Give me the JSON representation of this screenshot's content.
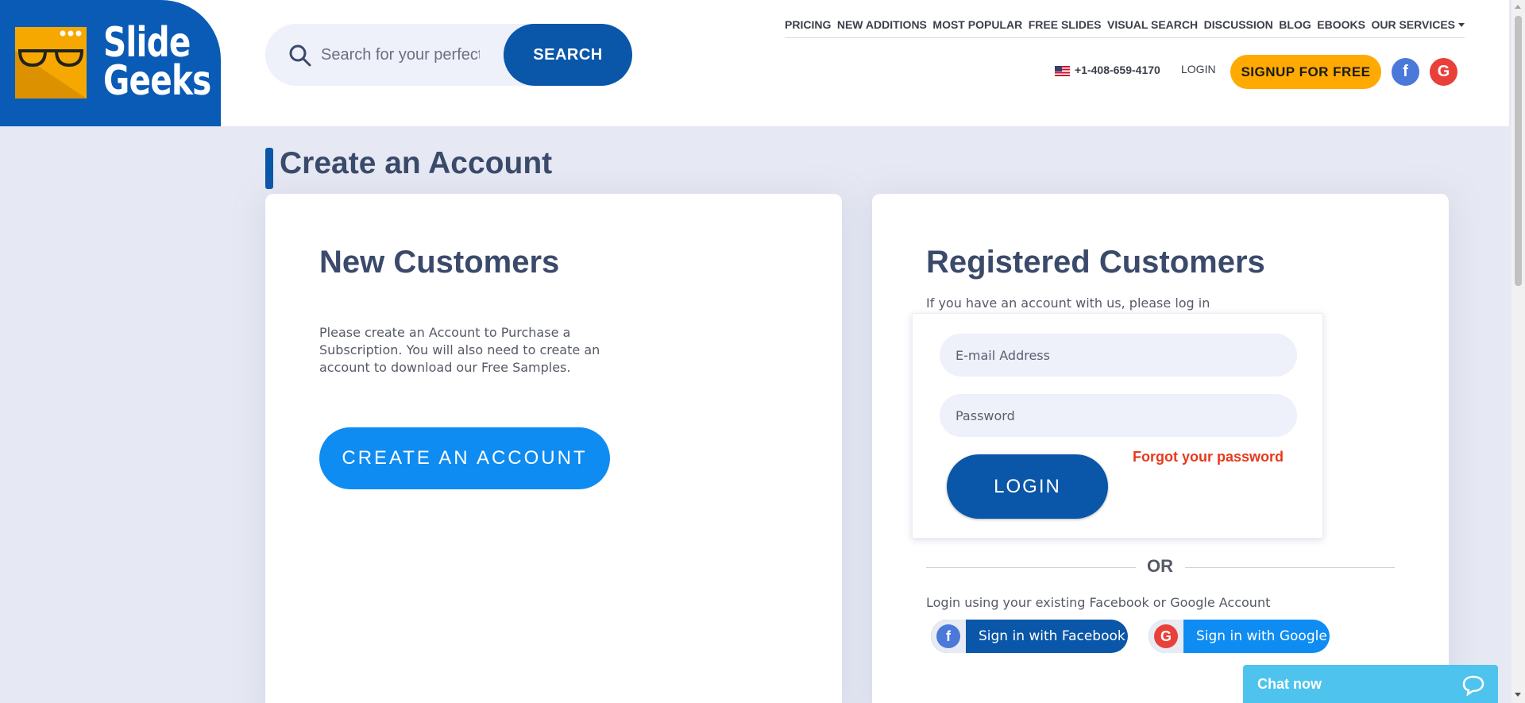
{
  "brand": {
    "line1": "Slide",
    "line2": "Geeks",
    "accent": "#0a5bb5",
    "logo_color": "#f7a800"
  },
  "search": {
    "placeholder": "Search for your perfect presentation",
    "button": "SEARCH"
  },
  "nav": {
    "items": [
      "PRICING",
      "NEW ADDITIONS",
      "MOST POPULAR",
      "FREE SLIDES",
      "VISUAL SEARCH",
      "DISCUSSION",
      "BLOG",
      "EBOOKS",
      "OUR SERVICES"
    ]
  },
  "account_bar": {
    "phone": "+1-408-659-4170",
    "login": "LOGIN",
    "signup": "SIGNUP FOR FREE",
    "facebook_icon": "f",
    "google_icon": "G"
  },
  "page": {
    "title": "Create an Account"
  },
  "new_customers": {
    "heading": "New Customers",
    "description": "Please create an Account to Purchase a Subscription. You will also need to create an account to download our Free Samples.",
    "create_button": "CREATE AN ACCOUNT"
  },
  "registered": {
    "heading": "Registered Customers",
    "description": "If you have an account with us, please log in",
    "email_placeholder": "E-mail Address",
    "password_placeholder": "Password",
    "login_button": "LOGIN",
    "forgot": "Forgot your password",
    "or": "OR",
    "social_desc": "Login using your existing Facebook or Google Account",
    "facebook_button": "Sign in with Facebook",
    "google_button": "Sign in with Google",
    "facebook_icon": "f",
    "google_icon": "G"
  },
  "chat": {
    "label": "Chat now"
  }
}
